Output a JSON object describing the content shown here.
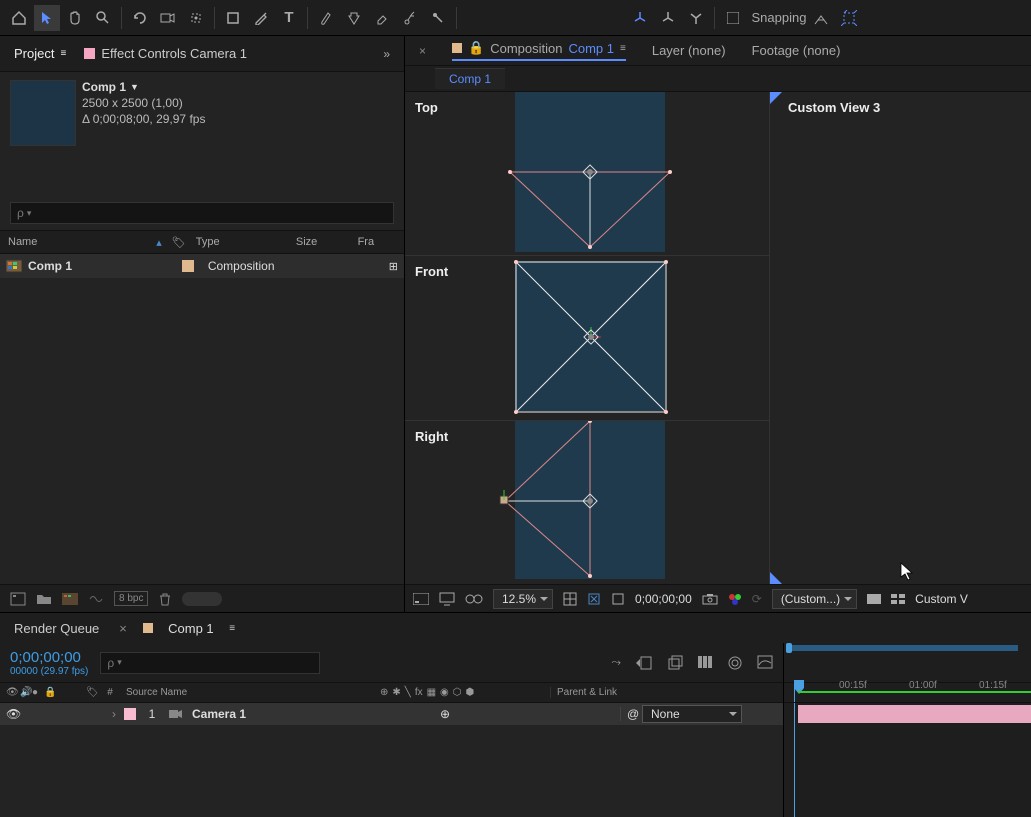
{
  "toolbar": {
    "snapping_label": "Snapping"
  },
  "project": {
    "tab_project": "Project",
    "tab_effect": "Effect Controls Camera 1",
    "comp_title": "Comp 1",
    "dims": "2500 x 2500 (1,00)",
    "duration_fps": "Δ 0;00;08;00, 29,97 fps",
    "col_name": "Name",
    "col_type": "Type",
    "col_size": "Size",
    "col_fr": "Fra",
    "row_name": "Comp 1",
    "row_type": "Composition",
    "bpc": "8 bpc"
  },
  "comp": {
    "tab_composition": "Composition",
    "tab_active": "Comp 1",
    "tab_layer": "Layer (none)",
    "tab_footage": "Footage (none)",
    "sub_tab": "Comp 1",
    "view_top": "Top",
    "view_front": "Front",
    "view_right": "Right",
    "view_custom": "Custom View 3",
    "zoom": "12.5%",
    "timecode": "0;00;00;00",
    "camera_dropdown": "(Custom...)",
    "view_dropdown": "Custom V"
  },
  "timeline": {
    "tab_render": "Render Queue",
    "tab_comp": "Comp 1",
    "timecode": "0;00;00;00",
    "timecode_sub": "00000 (29.97 fps)",
    "col_num": "#",
    "col_source": "Source Name",
    "col_parent": "Parent & Link",
    "layer_num": "1",
    "layer_name": "Camera 1",
    "parent_value": "None",
    "ruler": [
      "00:15f",
      "01:00f",
      "01:15f"
    ]
  }
}
